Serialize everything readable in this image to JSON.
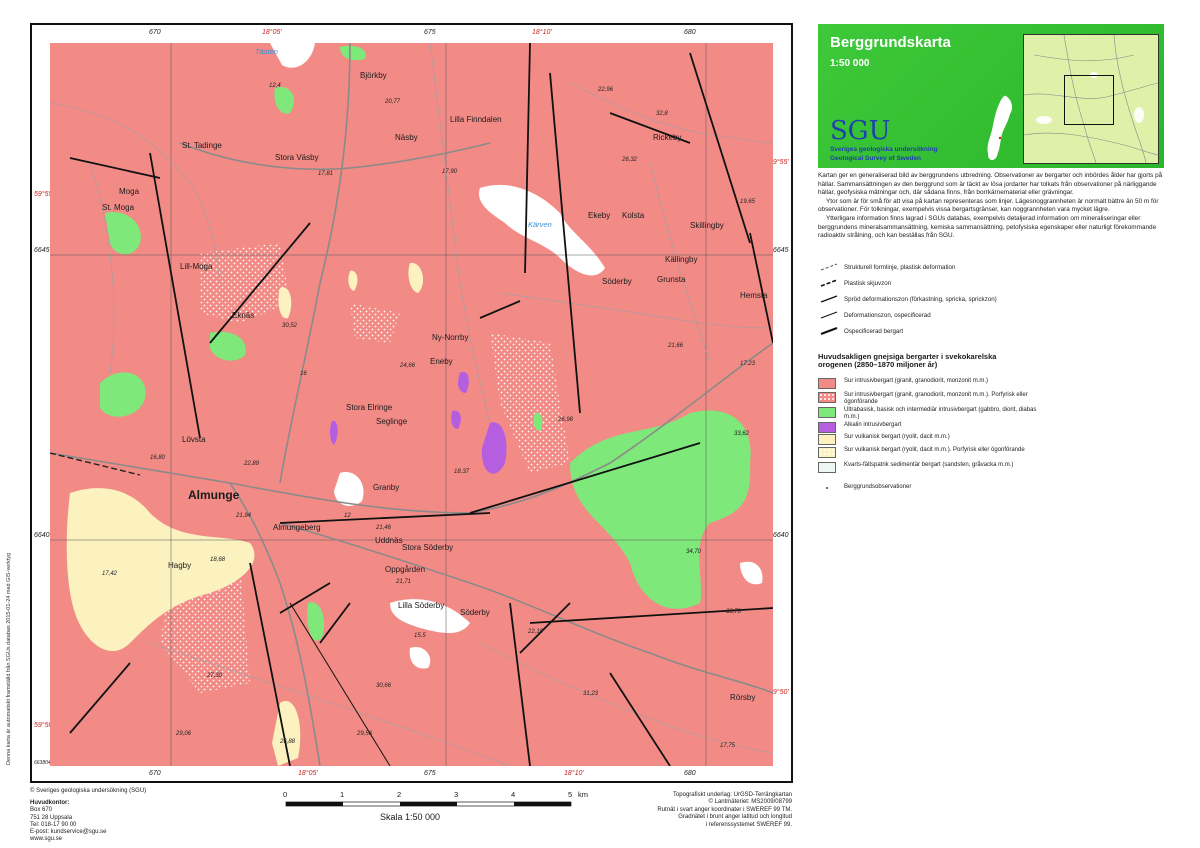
{
  "title": "Berggrundskarta",
  "scale": "1:50 000",
  "logo": {
    "text": "SGU",
    "line1": "Sveriges geologiska undersökning",
    "line2": "Geological Survey of Sweden"
  },
  "description": [
    "Kartan ger en generaliserad bild av berggrundens utbredning. Observationer av bergarter och inbördes ålder har gjorts på hällar. Sammansättningen av den berggrund som är täckt av lösa jordarter har tolkats från observationer på närliggande hällar, geofysiska mätningar och, där sådana finns, från borrkärnematerial eller grävningar.",
    "Ytor som är för små för att visa på kartan representeras som linjer. Lägesnoggrannheten är normalt bättre än 50 m för observationer. För tolkningar, exempelvis vissa bergartsgränser, kan noggrannheten vara mycket lägre.",
    "Ytterligare information finns lagrad i SGUs databas, exempelvis detaljerad information om mineraliseringar eller berggrundens mineralsammansättning, kemiska sammansättning, petofysiska egenskaper eller naturligt förekommande radioaktiv strålning, och kan beställas från SGU."
  ],
  "legend_lines": [
    "Strukturell formlinje, plastisk deformation",
    "Plastisk skjuvzon",
    "Spröd deformationszon (förkastning, spricka, sprickzon)",
    "Deformationszon, ospecificerad",
    "Ospecificerad bergart"
  ],
  "legend_heading": "Huvudsakligen gnejsiga bergarter i svekokarelska orogenen (2850–1870 miljoner år)",
  "legend_units": [
    {
      "label": "Sur intrusivbergart (granit, granodiorit, monzonit m.m.)",
      "color": "#f28b86",
      "pattern": false
    },
    {
      "label": "Sur intrusivbergart (granit, granodiorit, monzonit m.m.). Porfyrisk eller ögonförande",
      "color": "#f28b86",
      "pattern": true
    },
    {
      "label": "Ultrabasisk, basisk och intermediär intrusivbergart (gabbro, diorit, diabas m.m.)",
      "color": "#7ee87a",
      "pattern": false
    },
    {
      "label": "Alkalin intrusivbergart",
      "color": "#b65ee0",
      "pattern": false
    },
    {
      "label": "Sur vulkanisk bergart (ryolit, dacit m.m.)",
      "color": "#fbf2c0",
      "pattern": false
    },
    {
      "label": "Sur vulkanisk bergart (ryolit, dacit m.m.). Porfyrisk eller ögonförande",
      "color": "#fbf2c0",
      "pattern": true
    },
    {
      "label": "Kvarts-fältspatrik sedimentär bergart (sandsten, gråvacka m.m.)",
      "color": "#eef6f2",
      "pattern": false
    }
  ],
  "legend_obs": "Berggrundsobservationer",
  "grid": {
    "top": [
      "670",
      "675",
      "680"
    ],
    "top_red": [
      "18°05'",
      "18°10'"
    ],
    "side_left": [
      "59°55'",
      "6645",
      "6640",
      "59°50'",
      "6638042"
    ],
    "side_right": [
      "59°55'",
      "6645",
      "6640",
      "59°50'"
    ],
    "bottom": [
      "670",
      "675",
      "680"
    ],
    "bottom_red": [
      "18°05'",
      "18°10'"
    ]
  },
  "places": {
    "almunge": "Almunge",
    "almungeberg": "Almungeberg",
    "hagby": "Hagby",
    "bjorkby": "Björkby",
    "nasby": "Näsby",
    "lilla_finndalen": "Lilla Finndalen",
    "st_tadinge": "St. Tadinge",
    "stora_vasby": "Stora Väsby",
    "moga": "Moga",
    "st_moga": "St. Moga",
    "lill_moga": "Lill-Moga",
    "eknas": "Eknäs",
    "ny_norrby": "Ny-Norrby",
    "eneby": "Eneby",
    "stora_elringe": "Stora Elringe",
    "seglinge": "Seglinge",
    "lovsta": "Lövsta",
    "granby": "Granby",
    "uddnas": "Uddnäs",
    "stora_soderby": "Stora Söderby",
    "oppgarden": "Oppgården",
    "lilla_soderby": "Lilla Söderby",
    "soderby": "Söderby",
    "rickeby": "Rickeby",
    "ekeby": "Ekeby",
    "kolsta": "Kolsta",
    "skillingby": "Skillingby",
    "kallingby": "Källingby",
    "soderby2": "Söderby",
    "grunsta": "Grunsta",
    "hemsta": "Hemsta",
    "rorsby": "Rörsby",
    "karven": "Kärven",
    "tasten": "Tästen"
  },
  "elevations": [
    "12,4",
    "20,77",
    "17,81",
    "17,90",
    "22,96",
    "32,8",
    "26,32",
    "19,65",
    "30,52",
    "16",
    "24,66",
    "26,98",
    "16,80",
    "22,89",
    "18,37",
    "12",
    "21,46",
    "21,71",
    "33,62",
    "21,66",
    "17,23",
    "34,70",
    "17,42",
    "18,68",
    "21,94",
    "27,30",
    "29,06",
    "26,88",
    "29,56",
    "30,66",
    "31,23",
    "15,5",
    "22,10",
    "33,78",
    "17,75"
  ],
  "credits_vertical": "Denna karta är automatiskt framställd från SGUs databas 2015-01-24 med GIS-verktyg",
  "footer_left": {
    "copyright": "© Sveriges geologiska undersökning (SGU)",
    "hk_title": "Huvudkontor:",
    "lines": [
      "Box 670",
      "751 28 Uppsala",
      "Tel: 018-17 90 00",
      "E-post: kundservice@sgu.se",
      "www.sgu.se"
    ]
  },
  "scalebar": {
    "ticks": [
      "0",
      "1",
      "2",
      "3",
      "4",
      "5"
    ],
    "unit": "km",
    "caption": "Skala 1:50 000"
  },
  "footer_right": [
    "Topografiskt underlag: UrGSD-Terrängkartan",
    "© Lantmäteriet: MS2009/08799",
    "Rutnät i svart anger koordinater i SWEREF 99 TM.",
    "Gradnätet i brunt anger latitud och longitud",
    "i referenssystemet SWEREF 99."
  ]
}
